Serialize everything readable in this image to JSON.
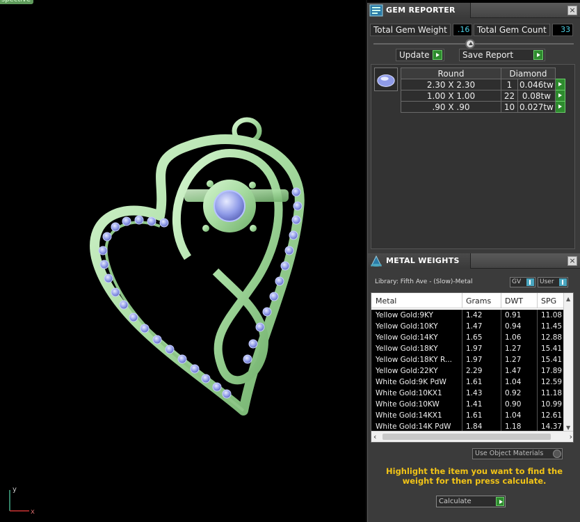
{
  "viewport": {
    "label": "spective",
    "axis_y": "y",
    "axis_x": "x"
  },
  "gem_reporter": {
    "title": "GEM REPORTER",
    "total_weight_label": "Total Gem Weight",
    "total_weight_value": ".16",
    "total_count_label": "Total Gem Count",
    "total_count_value": "33",
    "update_label": "Update",
    "save_label": "Save Report",
    "table_headers": [
      "Round",
      "Diamond"
    ],
    "rows": [
      {
        "size": "2.30 X 2.30",
        "count": "1",
        "weight": "0.046tw"
      },
      {
        "size": "1.00 X 1.00",
        "count": "22",
        "weight": "0.08tw"
      },
      {
        "size": ".90 X .90",
        "count": "10",
        "weight": "0.027tw"
      }
    ]
  },
  "metal_weights": {
    "title": "METAL WEIGHTS",
    "library": "Library: Fifth Ave - (Slow)-Metal",
    "dropdown_gv": "GV",
    "dropdown_user": "User",
    "columns": [
      "Metal",
      "Grams",
      "DWT",
      "SPG"
    ],
    "rows": [
      {
        "metal": "Yellow Gold:9KY",
        "grams": "1.42",
        "dwt": "0.91",
        "spg": "11.08"
      },
      {
        "metal": "Yellow Gold:10KY",
        "grams": "1.47",
        "dwt": "0.94",
        "spg": "11.45"
      },
      {
        "metal": "Yellow Gold:14KY",
        "grams": "1.65",
        "dwt": "1.06",
        "spg": "12.88"
      },
      {
        "metal": "Yellow Gold:18KY",
        "grams": "1.97",
        "dwt": "1.27",
        "spg": "15.41"
      },
      {
        "metal": "Yellow Gold:18KY R...",
        "grams": "1.97",
        "dwt": "1.27",
        "spg": "15.41"
      },
      {
        "metal": "Yellow Gold:22KY",
        "grams": "2.29",
        "dwt": "1.47",
        "spg": "17.89"
      },
      {
        "metal": "White Gold:9K PdW",
        "grams": "1.61",
        "dwt": "1.04",
        "spg": "12.59"
      },
      {
        "metal": "White Gold:10KX1",
        "grams": "1.43",
        "dwt": "0.92",
        "spg": "11.18"
      },
      {
        "metal": "White Gold:10KW",
        "grams": "1.41",
        "dwt": "0.90",
        "spg": "10.99"
      },
      {
        "metal": "White Gold:14KX1",
        "grams": "1.61",
        "dwt": "1.04",
        "spg": "12.61"
      },
      {
        "metal": "White Gold:14K PdW",
        "grams": "1.84",
        "dwt": "1.18",
        "spg": "14.37"
      }
    ],
    "use_object_materials": "Use Object Materials",
    "hint": "Highlight the item you want to find the weight for then press calculate.",
    "calculate_label": "Calculate"
  }
}
